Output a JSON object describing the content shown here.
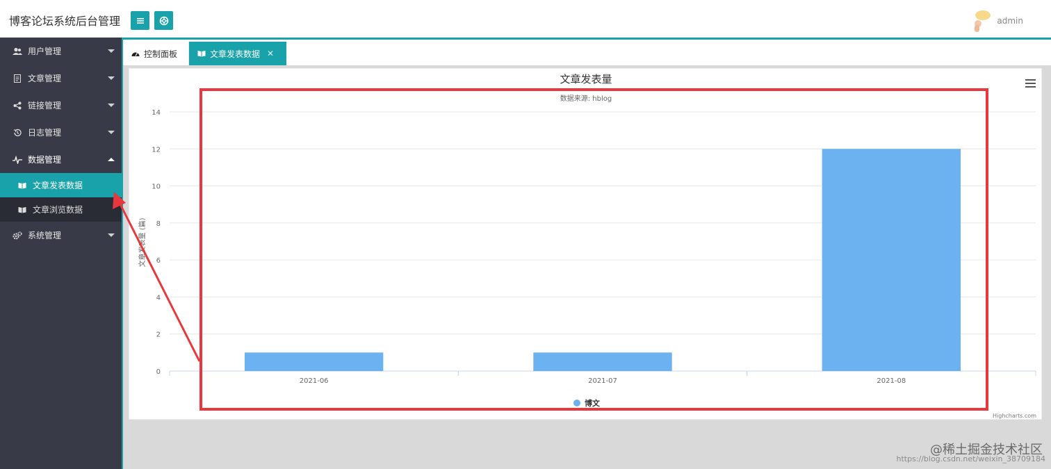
{
  "header": {
    "brand": "博客论坛系统后台管理",
    "user_name": "admin"
  },
  "sidebar": {
    "items": [
      {
        "label": "用户管理",
        "icon": "users-icon"
      },
      {
        "label": "文章管理",
        "icon": "document-icon"
      },
      {
        "label": "链接管理",
        "icon": "share-icon"
      },
      {
        "label": "日志管理",
        "icon": "history-icon"
      },
      {
        "label": "数据管理",
        "icon": "pulse-icon"
      },
      {
        "label": "系统管理",
        "icon": "gears-icon"
      }
    ],
    "submenu": [
      {
        "label": "文章发表数据",
        "icon": "book-icon",
        "active": true
      },
      {
        "label": "文章浏览数据",
        "icon": "book-icon",
        "active": false
      }
    ]
  },
  "tabs": [
    {
      "label": "控制面板",
      "icon": "dashboard-icon"
    },
    {
      "label": "文章发表数据",
      "icon": "book-icon",
      "close": "✕"
    }
  ],
  "chart_data": {
    "type": "bar",
    "title": "文章发表量",
    "subtitle": "数据来源: hblog",
    "ylabel": "文章发表量 (篇)",
    "xlabel": "",
    "categories": [
      "2021-06",
      "2021-07",
      "2021-08"
    ],
    "series": [
      {
        "name": "博文",
        "values": [
          1,
          1,
          12
        ]
      }
    ],
    "ylim": [
      0,
      14
    ],
    "yticks": [
      0,
      2,
      4,
      6,
      8,
      10,
      12,
      14
    ],
    "grid": true,
    "legend": "bottom-center",
    "credits": "Highcharts.com",
    "bar_color": "#6cb2f0"
  },
  "watermark": {
    "text": "@稀土掘金技术社区",
    "url": "https://blog.csdn.net/weixin_38709184"
  },
  "colors": {
    "accent": "#19a2aa",
    "sidebar": "#383b47",
    "highlight": "#e8383d"
  }
}
